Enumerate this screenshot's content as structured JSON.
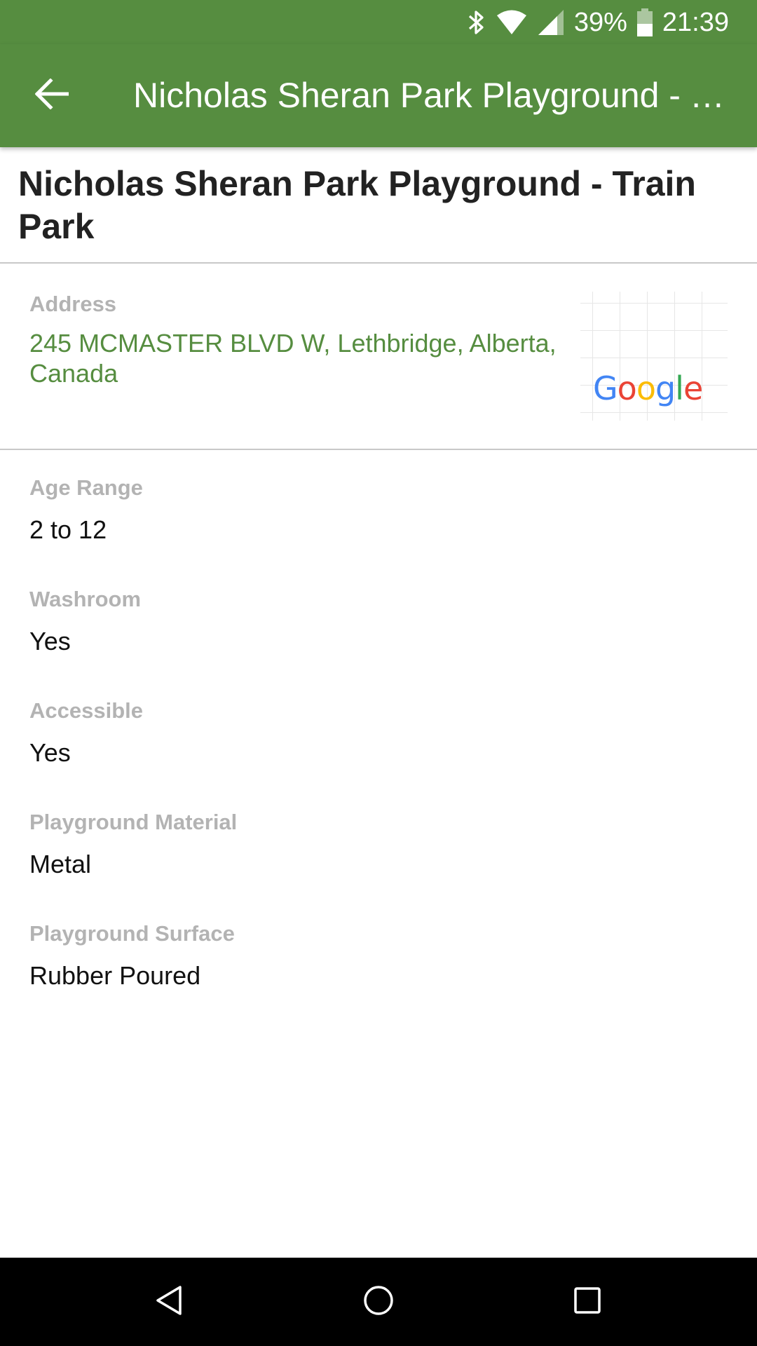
{
  "status_bar": {
    "battery_text": "39%",
    "time": "21:39",
    "icons": [
      "bluetooth-icon",
      "wifi-icon",
      "cell-signal-icon",
      "battery-icon"
    ]
  },
  "app_bar": {
    "title": "Nicholas Sheran Park Playground - Train Park",
    "back_icon": "back-arrow-icon"
  },
  "page": {
    "title": "Nicholas Sheran Park Playground - Train Park"
  },
  "address": {
    "label": "Address",
    "value": "245 MCMASTER BLVD W, Lethbridge, Alberta, Canada",
    "map_logo": "Google"
  },
  "details": [
    {
      "label": "Age Range",
      "value": "2 to 12"
    },
    {
      "label": "Washroom",
      "value": "Yes"
    },
    {
      "label": "Accessible",
      "value": "Yes"
    },
    {
      "label": "Playground Material",
      "value": "Metal"
    },
    {
      "label": "Playground Surface",
      "value": "Rubber Poured"
    }
  ],
  "nav_bar": {
    "icons": [
      "nav-back-icon",
      "nav-home-icon",
      "nav-recents-icon"
    ]
  },
  "colors": {
    "primary": "#568d40",
    "label_gray": "#b3b3b3",
    "divider": "#c8c8c8",
    "google_blue": "#4285f4",
    "google_red": "#ea4335",
    "google_yellow": "#fbbc05",
    "google_green": "#34a853"
  }
}
